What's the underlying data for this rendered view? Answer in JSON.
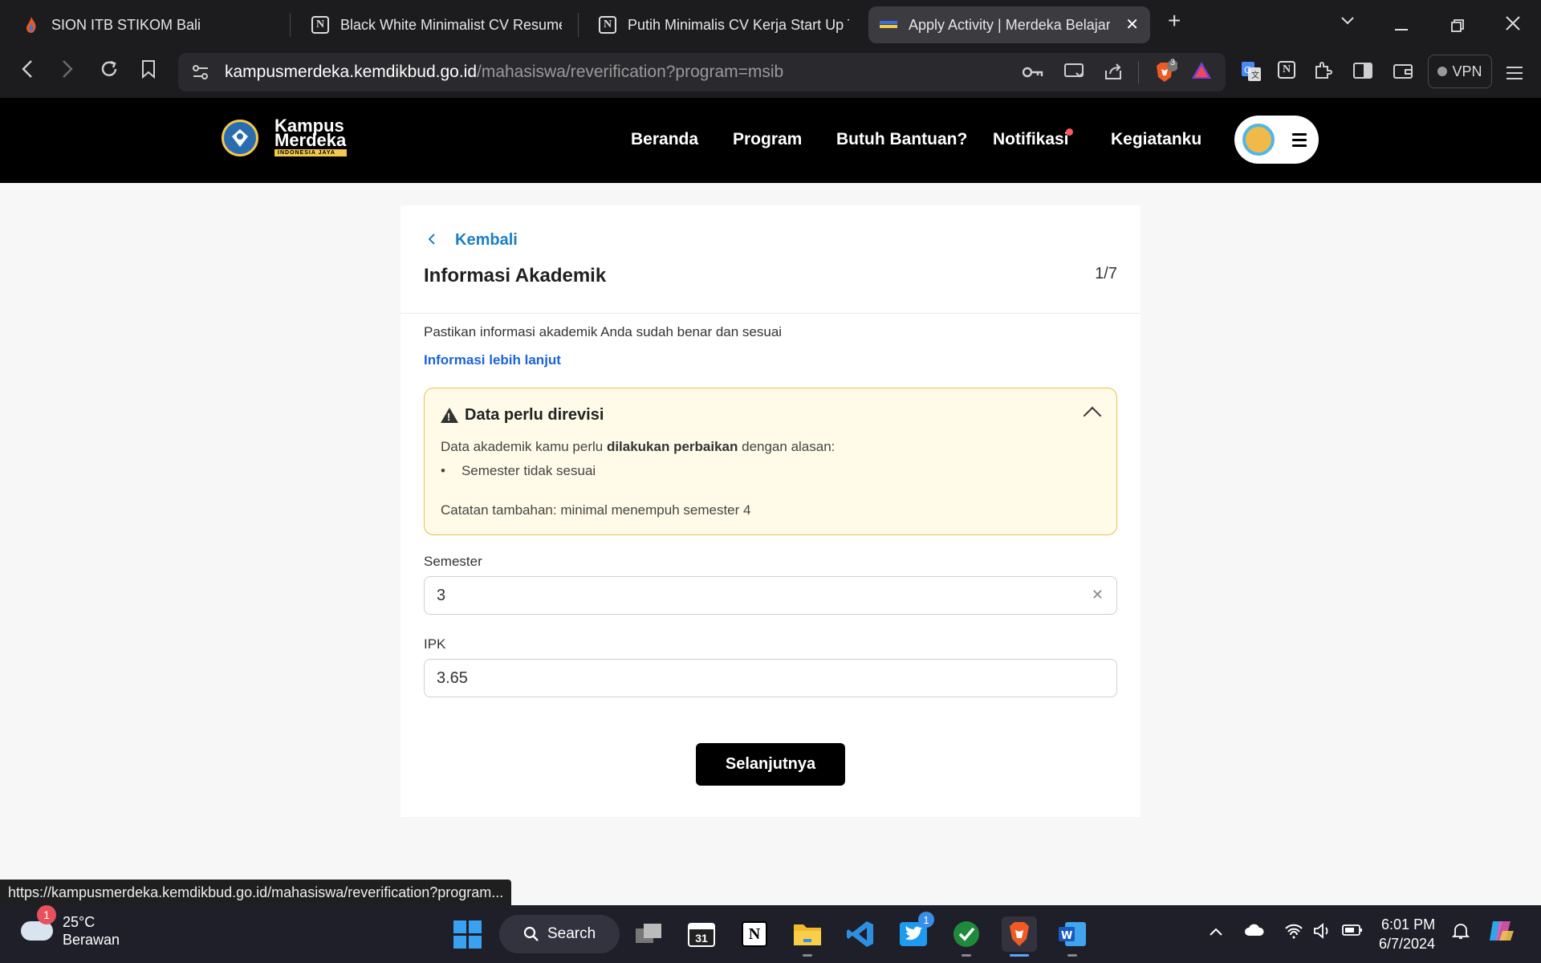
{
  "browser": {
    "tabs": [
      {
        "title": "SION ITB STIKOM Bali",
        "icon": "flame-icon"
      },
      {
        "title": "Black White Minimalist CV Resume A",
        "icon": "notion-icon"
      },
      {
        "title": "Putih Minimalis CV Kerja Start Up Tel",
        "icon": "notion-icon"
      },
      {
        "title": "Apply Activity | Merdeka Belajar",
        "icon": "merdeka-icon",
        "active": true
      }
    ],
    "url_host": "kampusmerdeka.kemdikbud.go.id",
    "url_path": "/mahasiswa/reverification?program=msib",
    "brave_badge": "3",
    "vpn_label": "VPN"
  },
  "site": {
    "logo_text": "Kampus Merdeka",
    "logo_subtext": "INDONESIA JAYA",
    "nav": [
      "Beranda",
      "Program",
      "Butuh Bantuan?",
      "Notifikasi",
      "Kegiatanku"
    ]
  },
  "form": {
    "back_label": "Kembali",
    "title": "Informasi Akademik",
    "step": "1/7",
    "description": "Pastikan informasi akademik Anda sudah benar dan sesuai",
    "info_link": "Informasi lebih lanjut",
    "alert": {
      "title": "Data perlu direvisi",
      "body_prefix": "Data akademik kamu perlu ",
      "body_bold": "dilakukan perbaikan",
      "body_suffix": " dengan alasan:",
      "bullet": "Semester tidak sesuai",
      "note": "Catatan tambahan: minimal menempuh semester 4"
    },
    "semester_label": "Semester",
    "semester_value": "3",
    "ipk_label": "IPK",
    "ipk_value": "3.65",
    "next_button": "Selanjutnya"
  },
  "status_bar_url": "https://kampusmerdeka.kemdikbud.go.id/mahasiswa/reverification?program...",
  "taskbar": {
    "weather_badge": "1",
    "temperature": "25°C",
    "weather_desc": "Berawan",
    "search_label": "Search",
    "calendar_day": "31",
    "twitter_badge": "1",
    "time": "6:01 PM",
    "date": "6/7/2024"
  },
  "colors": {
    "accent_link": "#1a7fc4",
    "info_link": "#1a63d8",
    "alert_bg": "#fffbe8",
    "alert_border": "#e8c24a",
    "header_bg": "#000000"
  }
}
